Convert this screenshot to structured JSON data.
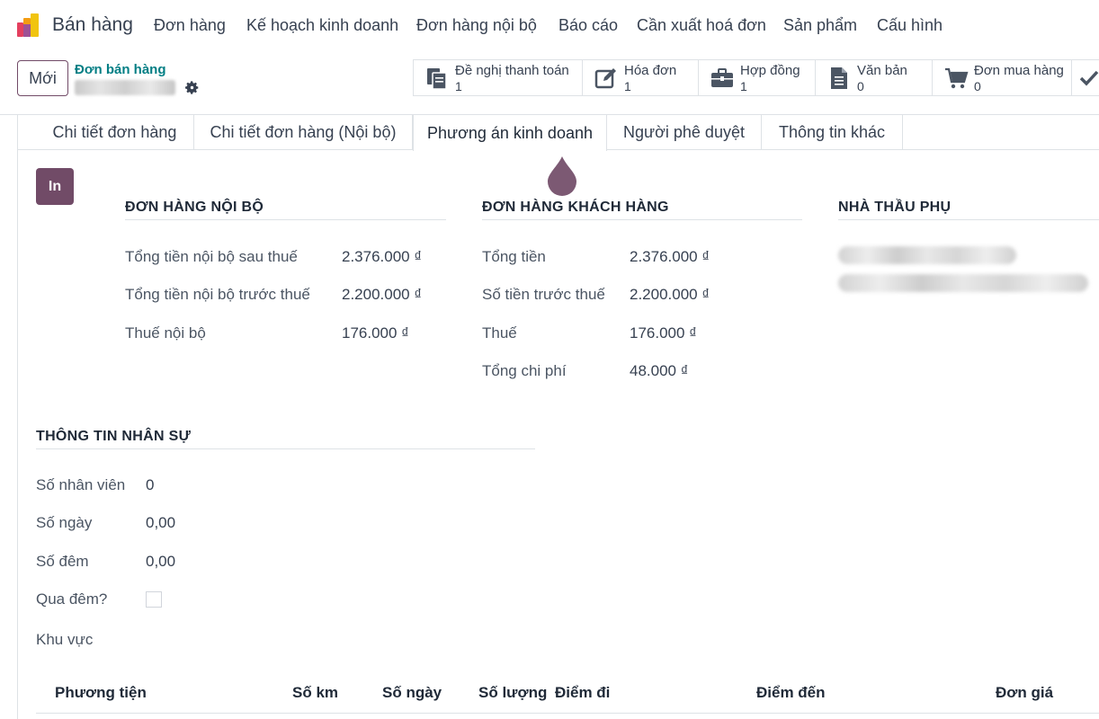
{
  "app": {
    "name": "Bán hàng",
    "logo_icon": "odoo-app-logo-icon"
  },
  "nav": [
    "Đơn hàng",
    "Kế hoạch kinh doanh",
    "Đơn hàng nội bộ",
    "Báo cáo",
    "Cần xuất hoá đơn",
    "Sản phẩm",
    "Cấu hình"
  ],
  "control": {
    "new_label": "Mới",
    "breadcrumb": "Đơn bán hàng",
    "gear_icon": "gear-icon"
  },
  "smart_buttons": [
    {
      "label": "Đề nghị thanh toán",
      "value": "1",
      "icon": "document-stack-icon"
    },
    {
      "label": "Hóa đơn",
      "value": "1",
      "icon": "pencil-square-icon"
    },
    {
      "label": "Hợp đồng",
      "value": "1",
      "icon": "briefcase-icon"
    },
    {
      "label": "Văn bản",
      "value": "0",
      "icon": "file-text-icon"
    },
    {
      "label": "Đơn mua hàng",
      "value": "0",
      "icon": "shopping-cart-icon"
    }
  ],
  "tabs": [
    "Chi tiết đơn hàng",
    "Chi tiết đơn hàng (Nội bộ)",
    "Phương án kinh doanh",
    "Người phê duyệt",
    "Thông tin khác"
  ],
  "print_label": "In",
  "internal": {
    "title": "ĐƠN HÀNG NỘI BỘ",
    "rows": [
      {
        "label": "Tổng tiền nội bộ sau thuế",
        "value": "2.376.000 ₫"
      },
      {
        "label": "Tổng tiền nội bộ trước thuế",
        "value": "2.200.000 ₫"
      },
      {
        "label": "Thuế nội bộ",
        "value": "176.000 ₫"
      }
    ]
  },
  "customer": {
    "title": "ĐƠN HÀNG KHÁCH HÀNG",
    "rows": [
      {
        "label": "Tổng tiền",
        "value": "2.376.000 ₫"
      },
      {
        "label": "Số tiền trước thuế",
        "value": "2.200.000 ₫"
      },
      {
        "label": "Thuế",
        "value": "176.000 ₫"
      },
      {
        "label": "Tổng chi phí",
        "value": "48.000 ₫"
      }
    ]
  },
  "subcontractor": {
    "title": "NHÀ THẦU PHỤ"
  },
  "hr": {
    "title": "THÔNG TIN NHÂN SỰ",
    "rows": [
      {
        "label": "Số nhân viên",
        "value": "0"
      },
      {
        "label": "Số ngày",
        "value": "0,00"
      },
      {
        "label": "Số đêm",
        "value": "0,00"
      },
      {
        "label": "Qua đêm?",
        "value": ""
      },
      {
        "label": "Khu vực",
        "value": ""
      }
    ]
  },
  "table": {
    "headers": [
      "Phương tiện",
      "Số km",
      "Số ngày",
      "Số lượng",
      "Điểm đi",
      "Điểm đến",
      "Đơn giá"
    ]
  },
  "colors": {
    "brand": "#714b67",
    "link": "#017e84"
  }
}
